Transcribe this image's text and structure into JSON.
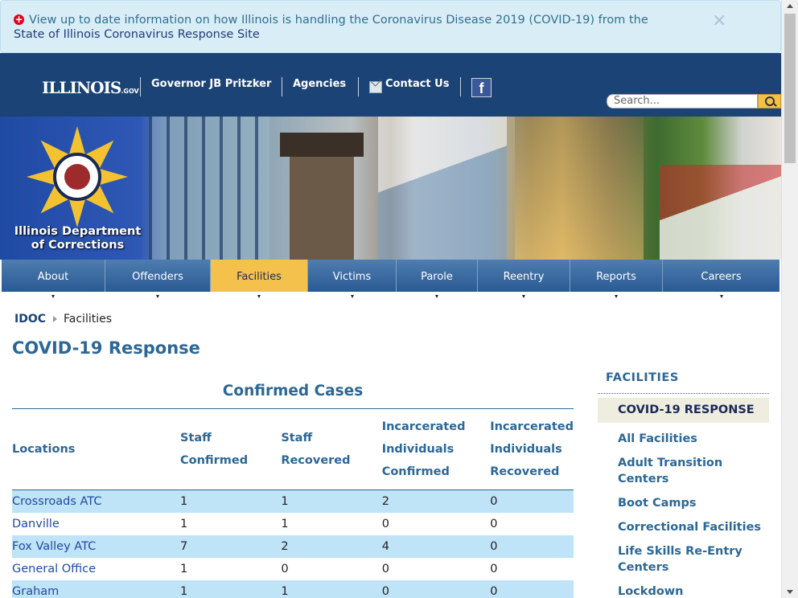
{
  "alert": {
    "message": "View up to date information on how Illinois is handling the Coronavirus Disease 2019 (COVID-19) from the",
    "link_text": "State of Illinois Coronavirus Response Site",
    "close": "×",
    "icon": "plus-circle-icon"
  },
  "header": {
    "logo_text": "ILLINOIS",
    "logo_suffix": ".GOV",
    "links": [
      "Governor JB Pritzker",
      "Agencies",
      "Contact Us"
    ],
    "facebook_glyph": "f",
    "search_placeholder": "Search..."
  },
  "banner": {
    "dept_name": "Illinois Department of Corrections",
    "seal_alt": "Illinois Department of Corrections seal"
  },
  "nav": {
    "tabs": [
      "About",
      "Offenders",
      "Facilities",
      "Victims",
      "Parole",
      "Reentry",
      "Reports",
      "Careers"
    ],
    "active": "Facilities"
  },
  "breadcrumb": {
    "home": "IDOC",
    "current": "Facilities"
  },
  "page_title": "COVID-19 Response",
  "table": {
    "title": "Confirmed Cases",
    "headers": {
      "locations": "Locations",
      "staff_confirmed": [
        "Staff",
        "Confirmed"
      ],
      "staff_recovered": [
        "Staff",
        "Recovered"
      ],
      "inc_confirmed": [
        "Incarcerated",
        "Individuals",
        "Confirmed"
      ],
      "inc_recovered": [
        "Incarcerated",
        "Individuals",
        "Recovered"
      ]
    },
    "rows": [
      [
        "Crossroads ATC",
        "1",
        "1",
        "2",
        "0"
      ],
      [
        "Danville",
        "1",
        "1",
        "0",
        "0"
      ],
      [
        "Fox Valley ATC",
        "7",
        "2",
        "4",
        "0"
      ],
      [
        "General Office",
        "1",
        "0",
        "0",
        "0"
      ],
      [
        "Graham",
        "1",
        "1",
        "0",
        "0"
      ]
    ]
  },
  "sidebar": {
    "title": "FACILITIES",
    "items": [
      "COVID-19 RESPONSE",
      "All Facilities",
      "Adult Transition Centers",
      "Boot Camps",
      "Correctional Facilities",
      "Life Skills Re-Entry Centers",
      "Lockdown"
    ]
  },
  "colors": {
    "brand_navy": "#1b4375",
    "title_blue": "#2c6796",
    "active_tab": "#f5c14d",
    "row_alt": "#bfe3f7",
    "alert_bg": "#d9edf7"
  }
}
